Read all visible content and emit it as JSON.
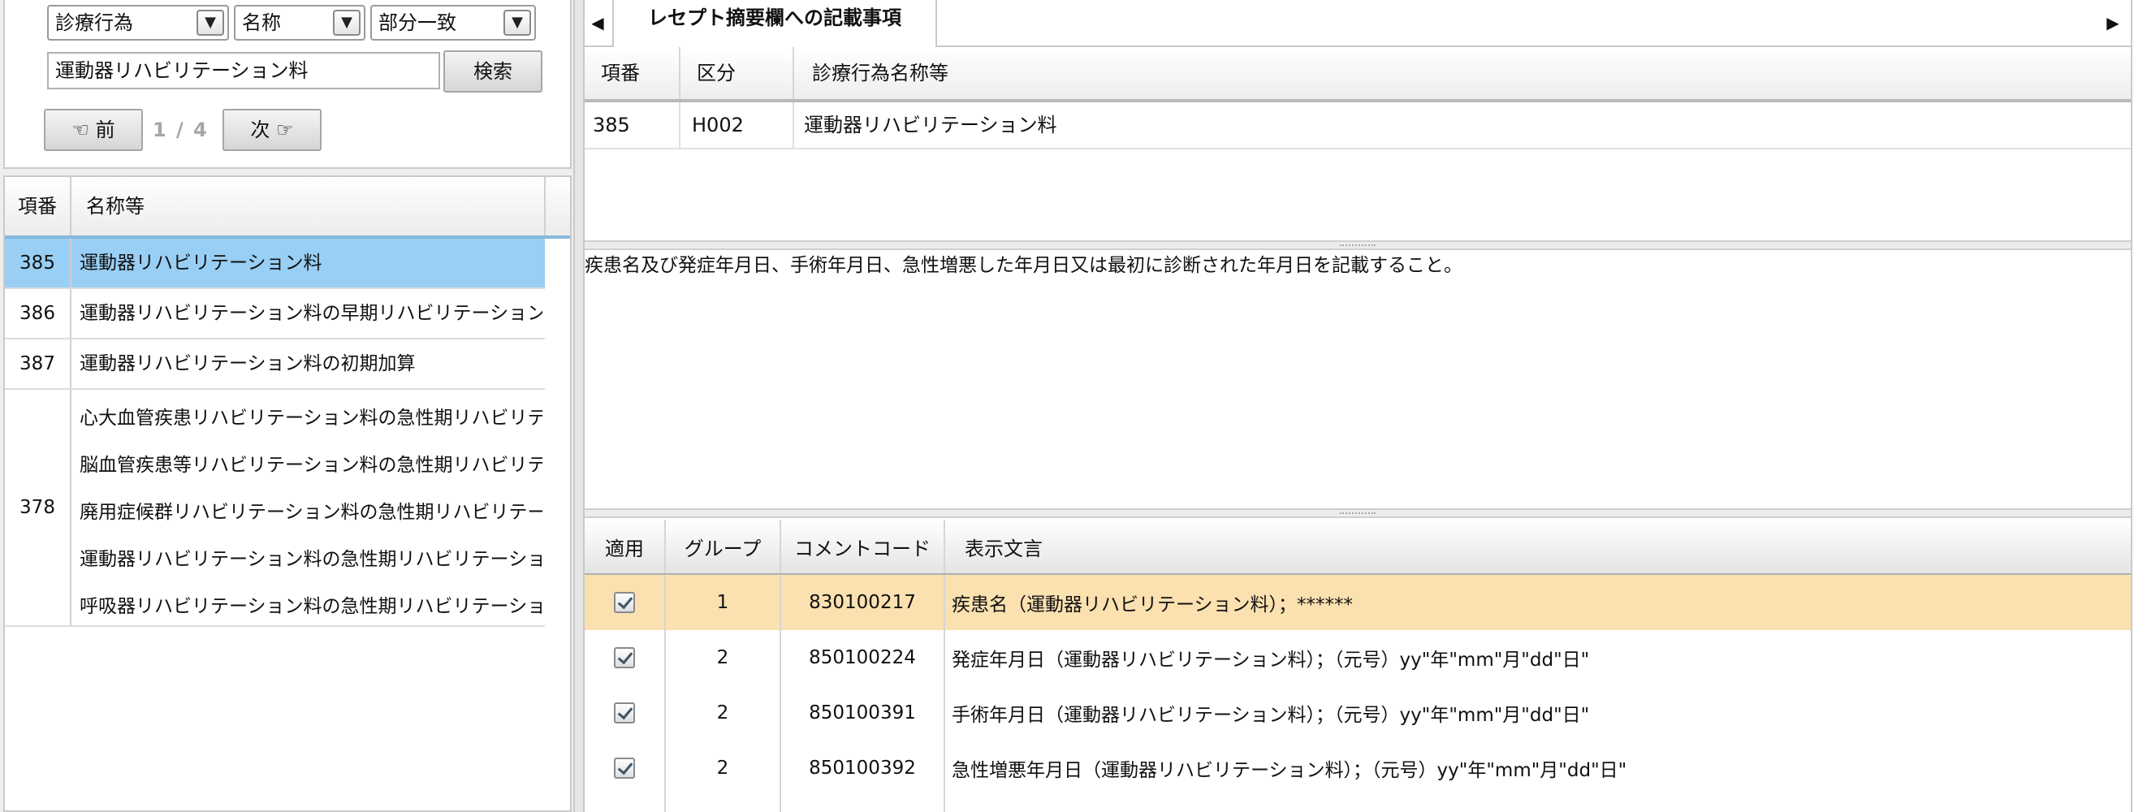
{
  "search": {
    "category": "診療行為",
    "field": "名称",
    "match": "部分一致",
    "keyword": "運動器リハビリテーション料",
    "search_button": "検索",
    "prev_button": "☜ 前",
    "next_button": "次 ☞",
    "page_indicator": "1 / 4"
  },
  "results": {
    "headers": {
      "no": "項番",
      "name": "名称等"
    },
    "rows": [
      {
        "no": "385",
        "names": [
          "運動器リハビリテーション料"
        ]
      },
      {
        "no": "386",
        "names": [
          "運動器リハビリテーション料の早期リハビリテーション加"
        ]
      },
      {
        "no": "387",
        "names": [
          "運動器リハビリテーション料の初期加算"
        ]
      },
      {
        "no": "378",
        "names": [
          "心大血管疾患リハビリテーション料の急性期リハビリテー",
          "脳血管疾患等リハビリテーション料の急性期リハビリテー",
          "廃用症候群リハビリテーション料の急性期リハビリテーシ",
          "運動器リハビリテーション料の急性期リハビリテーション",
          "呼吸器リハビリテーション料の急性期リハビリテーション"
        ]
      }
    ]
  },
  "tab": {
    "label": "レセプト摘要欄への記載事項"
  },
  "item_table": {
    "headers": {
      "no": "項番",
      "kubun": "区分",
      "name": "診療行為名称等"
    },
    "row": {
      "no": "385",
      "kubun": "H002",
      "name": "運動器リハビリテーション料"
    }
  },
  "description": "疾患名及び発症年月日、手術年月日、急性増悪した年月日又は最初に診断された年月日を記載すること。",
  "comment_table": {
    "headers": {
      "apply": "適用",
      "group": "グループ",
      "code": "コメントコード",
      "text": "表示文言"
    },
    "rows": [
      {
        "checked": true,
        "group": "1",
        "code": "830100217",
        "text": "疾患名（運動器リハビリテーション料）；******"
      },
      {
        "checked": true,
        "group": "2",
        "code": "850100224",
        "text": "発症年月日（運動器リハビリテーション料）；（元号）yy\"年\"mm\"月\"dd\"日\""
      },
      {
        "checked": true,
        "group": "2",
        "code": "850100391",
        "text": "手術年月日（運動器リハビリテーション料）；（元号）yy\"年\"mm\"月\"dd\"日\""
      },
      {
        "checked": true,
        "group": "2",
        "code": "850100392",
        "text": "急性増悪年月日（運動器リハビリテーション料）；（元号）yy\"年\"mm\"月\"dd\"日\""
      }
    ]
  },
  "colors": {
    "selected_result": "#99cff5",
    "selected_comment": "#fbe0b0",
    "header_accent": "#86b8de"
  }
}
